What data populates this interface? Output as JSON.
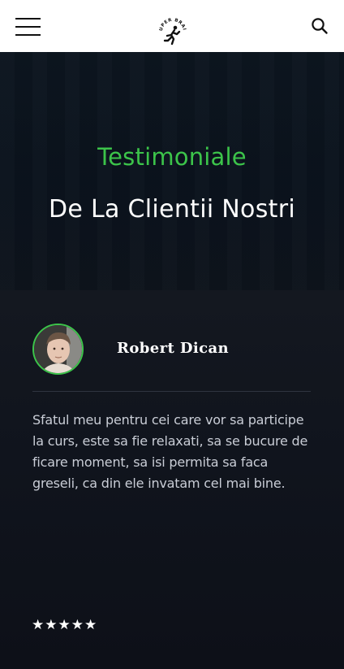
{
  "header": {
    "menu_icon": "hamburger-menu-icon",
    "logo_text": "SUPER BRAIN",
    "search_icon": "search-icon"
  },
  "hero": {
    "subtitle": "Testimoniale",
    "title": "De La Clientii Nostri"
  },
  "testimonial": {
    "author": "Robert Dican",
    "quote": "Sfatul meu pentru cei care vor sa participe la curs, este sa fie relaxati, sa se bucure de ficare moment, sa isi permita sa faca greseli, ca din ele invatam cel mai bine.",
    "rating": 5,
    "rating_max": 5,
    "star_glyph": "★"
  },
  "colors": {
    "accent_green": "#3cc44a",
    "background_dark": "#0f131c",
    "header_bg": "#ffffff"
  }
}
